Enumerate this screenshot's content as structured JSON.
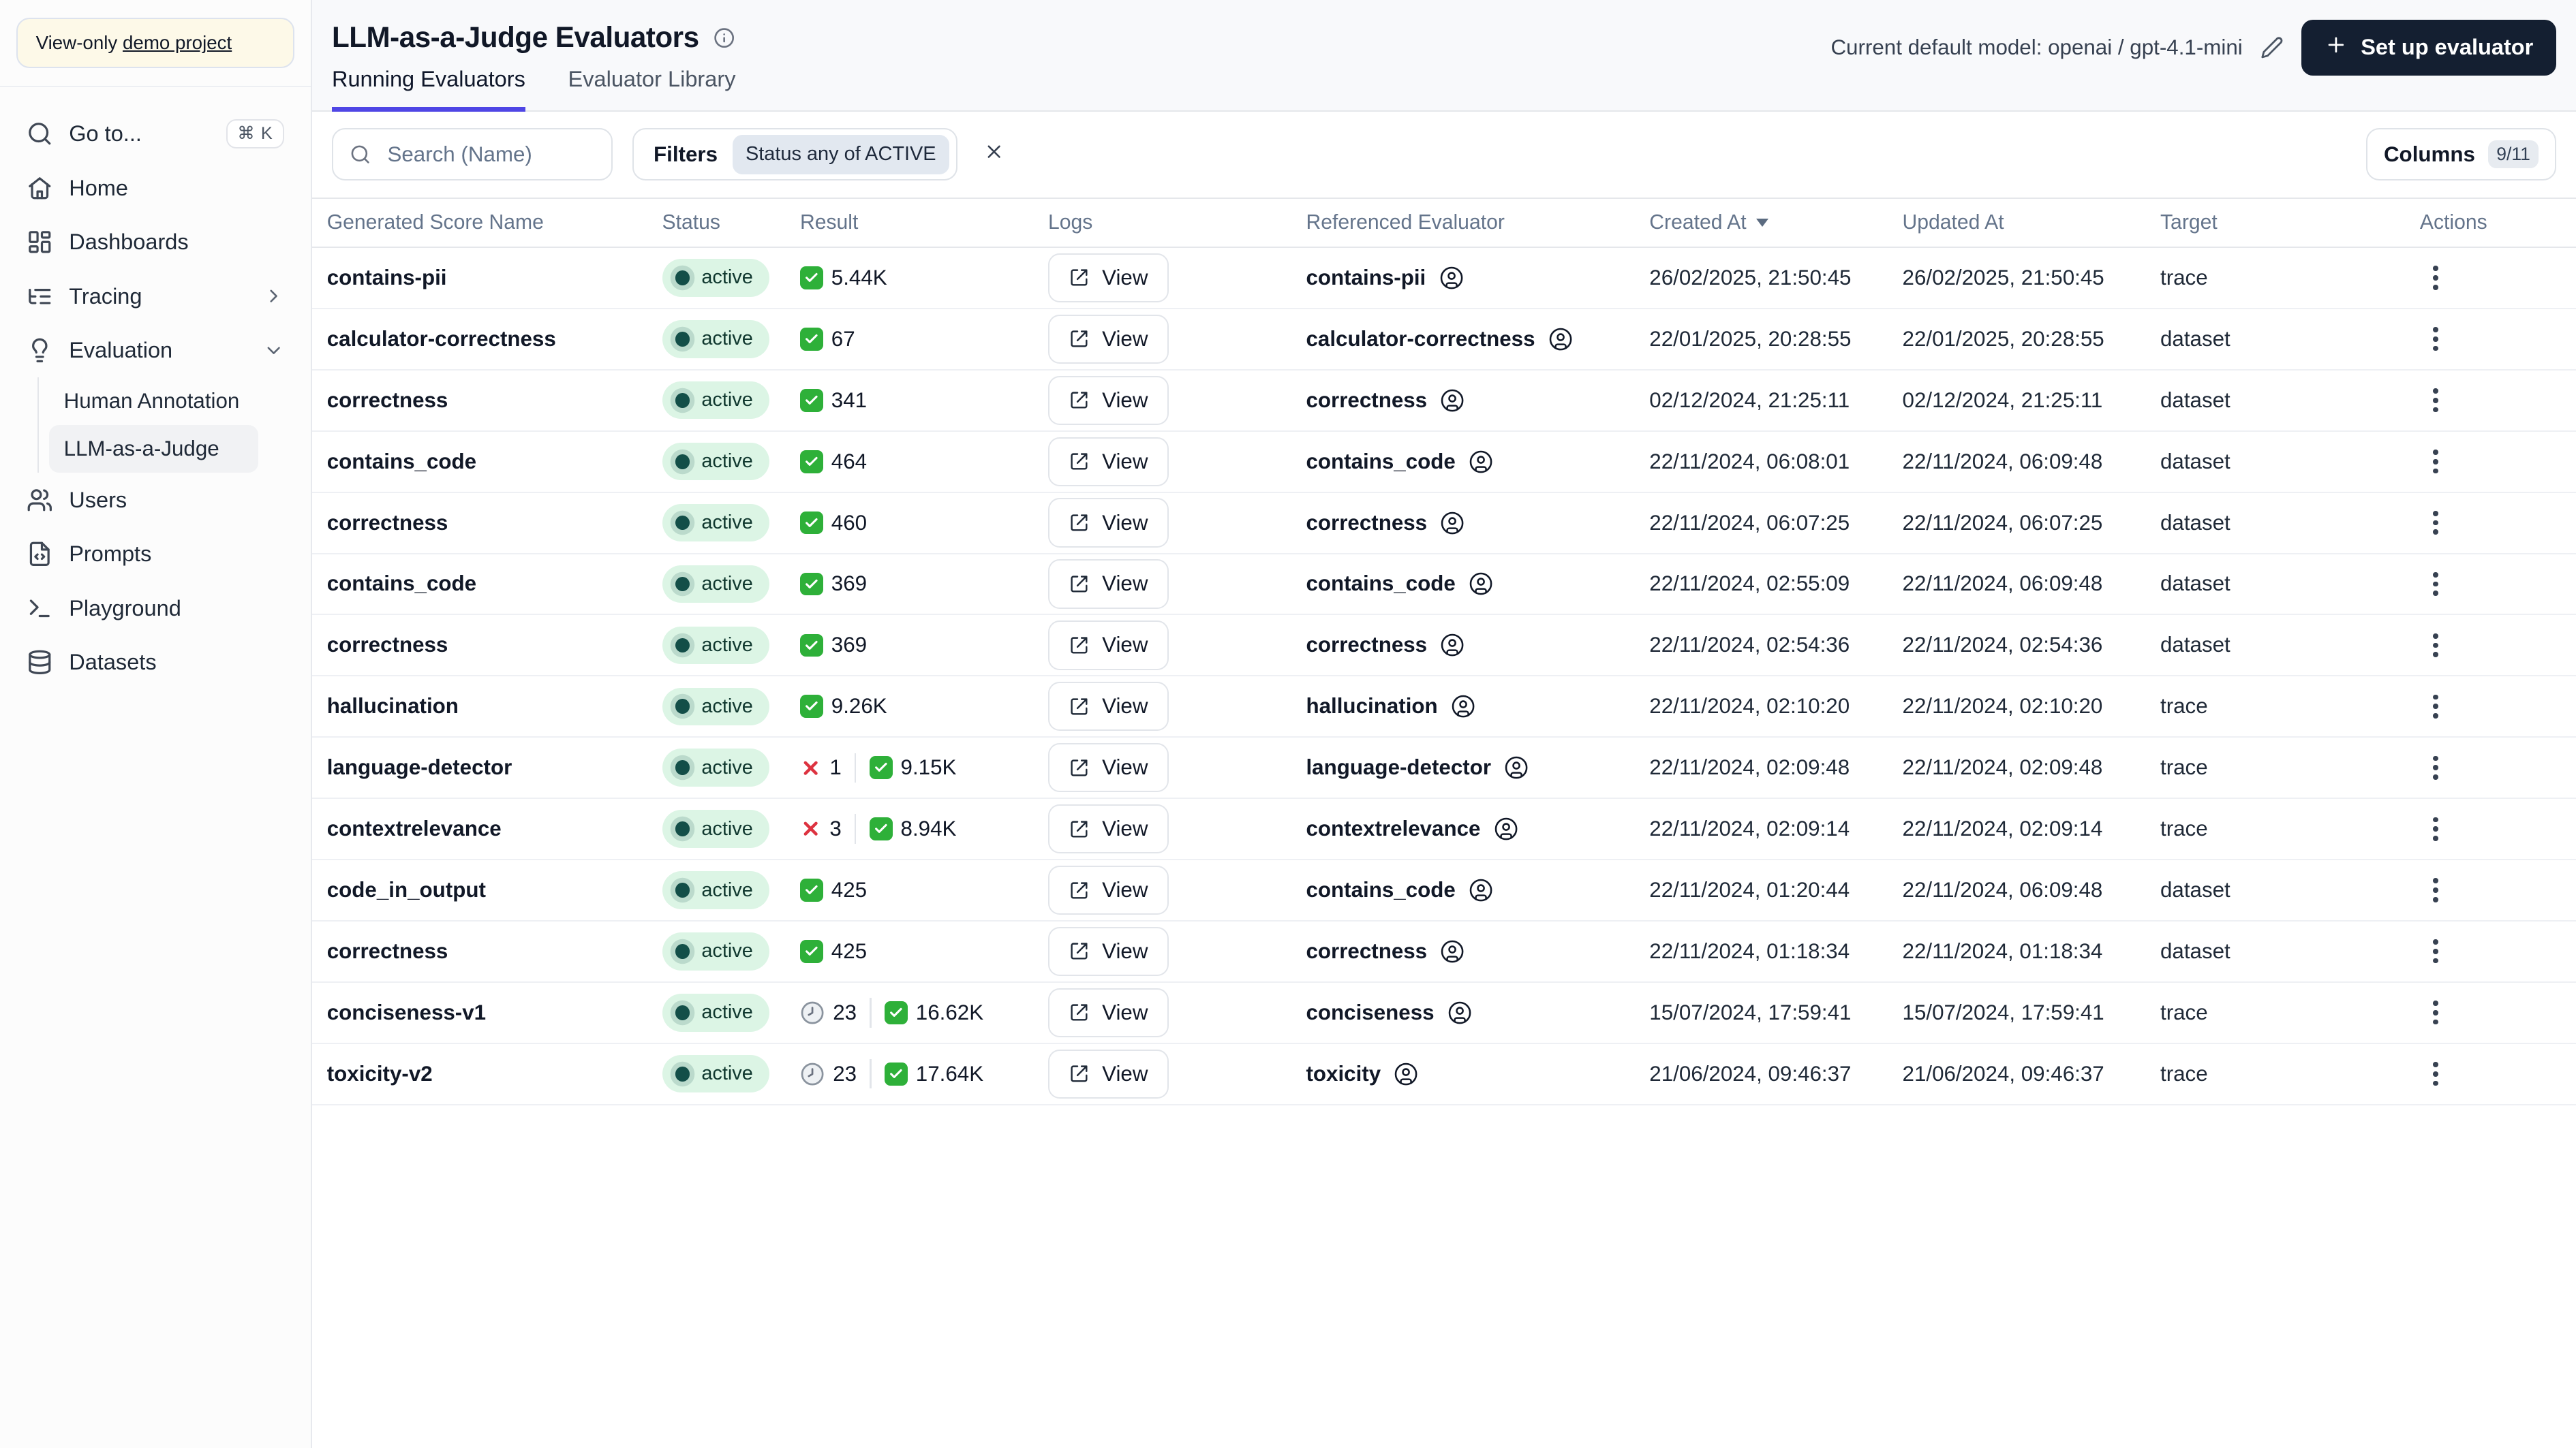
{
  "colors": {
    "accent": "#4f46e5",
    "active_badge_bg": "#dcf5e5",
    "active_dot": "#134e48",
    "success_green": "#2eb039",
    "error_red": "#dd3340",
    "dark_button": "#141f31",
    "banner_bg": "#fdf9e8"
  },
  "sidebar": {
    "banner": {
      "prefix": "View-only ",
      "link": "demo project"
    },
    "go_to": {
      "icon": "search",
      "label": "Go to...",
      "shortcut": "⌘ K"
    },
    "nav": [
      {
        "icon": "home",
        "label": "Home"
      },
      {
        "icon": "dashboards",
        "label": "Dashboards"
      },
      {
        "icon": "tracing",
        "label": "Tracing",
        "chevron": "right"
      },
      {
        "icon": "evaluation",
        "label": "Evaluation",
        "chevron": "down",
        "children": [
          {
            "label": "Human Annotation",
            "selected": false
          },
          {
            "label": "LLM-as-a-Judge",
            "selected": true
          }
        ]
      },
      {
        "icon": "users",
        "label": "Users"
      },
      {
        "icon": "prompts",
        "label": "Prompts"
      },
      {
        "icon": "playground",
        "label": "Playground"
      },
      {
        "icon": "datasets",
        "label": "Datasets"
      }
    ]
  },
  "header": {
    "title": "LLM-as-a-Judge Evaluators",
    "model_label": "Current default model: openai / gpt-4.1-mini",
    "setup_label": "Set up evaluator"
  },
  "tabs": [
    {
      "label": "Running Evaluators",
      "active": true
    },
    {
      "label": "Evaluator Library",
      "active": false
    }
  ],
  "toolbar": {
    "search_placeholder": "Search (Name)",
    "filters_label": "Filters",
    "filter_chip": "Status any of ACTIVE",
    "columns_label": "Columns",
    "columns_badge": "9/11"
  },
  "table": {
    "columns": [
      "Generated Score Name",
      "Status",
      "Result",
      "Logs",
      "Referenced Evaluator",
      "Created At",
      "Updated At",
      "Target",
      "Actions"
    ],
    "sorted_by": "Created At",
    "sort_direction": "desc",
    "view_label": "View",
    "rows": [
      {
        "name": "contains-pii",
        "status": "active",
        "result": {
          "success": "5.44K"
        },
        "referenced": "contains-pii",
        "created": "26/02/2025, 21:50:45",
        "updated": "26/02/2025, 21:50:45",
        "target": "trace"
      },
      {
        "name": "calculator-correctness",
        "status": "active",
        "result": {
          "success": "67"
        },
        "referenced": "calculator-correctness",
        "created": "22/01/2025, 20:28:55",
        "updated": "22/01/2025, 20:28:55",
        "target": "dataset"
      },
      {
        "name": "correctness",
        "status": "active",
        "result": {
          "success": "341"
        },
        "referenced": "correctness",
        "created": "02/12/2024, 21:25:11",
        "updated": "02/12/2024, 21:25:11",
        "target": "dataset"
      },
      {
        "name": "contains_code",
        "status": "active",
        "result": {
          "success": "464"
        },
        "referenced": "contains_code",
        "created": "22/11/2024, 06:08:01",
        "updated": "22/11/2024, 06:09:48",
        "target": "dataset"
      },
      {
        "name": "correctness",
        "status": "active",
        "result": {
          "success": "460"
        },
        "referenced": "correctness",
        "created": "22/11/2024, 06:07:25",
        "updated": "22/11/2024, 06:07:25",
        "target": "dataset"
      },
      {
        "name": "contains_code",
        "status": "active",
        "result": {
          "success": "369"
        },
        "referenced": "contains_code",
        "created": "22/11/2024, 02:55:09",
        "updated": "22/11/2024, 06:09:48",
        "target": "dataset"
      },
      {
        "name": "correctness",
        "status": "active",
        "result": {
          "success": "369"
        },
        "referenced": "correctness",
        "created": "22/11/2024, 02:54:36",
        "updated": "22/11/2024, 02:54:36",
        "target": "dataset"
      },
      {
        "name": "hallucination",
        "status": "active",
        "result": {
          "success": "9.26K"
        },
        "referenced": "hallucination",
        "created": "22/11/2024, 02:10:20",
        "updated": "22/11/2024, 02:10:20",
        "target": "trace"
      },
      {
        "name": "language-detector",
        "status": "active",
        "result": {
          "error": "1",
          "success": "9.15K"
        },
        "referenced": "language-detector",
        "created": "22/11/2024, 02:09:48",
        "updated": "22/11/2024, 02:09:48",
        "target": "trace"
      },
      {
        "name": "contextrelevance",
        "status": "active",
        "result": {
          "error": "3",
          "success": "8.94K"
        },
        "referenced": "contextrelevance",
        "created": "22/11/2024, 02:09:14",
        "updated": "22/11/2024, 02:09:14",
        "target": "trace"
      },
      {
        "name": "code_in_output",
        "status": "active",
        "result": {
          "success": "425"
        },
        "referenced": "contains_code",
        "created": "22/11/2024, 01:20:44",
        "updated": "22/11/2024, 06:09:48",
        "target": "dataset"
      },
      {
        "name": "correctness",
        "status": "active",
        "result": {
          "success": "425"
        },
        "referenced": "correctness",
        "created": "22/11/2024, 01:18:34",
        "updated": "22/11/2024, 01:18:34",
        "target": "dataset"
      },
      {
        "name": "conciseness-v1",
        "status": "active",
        "result": {
          "pending": "23",
          "success": "16.62K"
        },
        "referenced": "conciseness",
        "created": "15/07/2024, 17:59:41",
        "updated": "15/07/2024, 17:59:41",
        "target": "trace"
      },
      {
        "name": "toxicity-v2",
        "status": "active",
        "result": {
          "pending": "23",
          "success": "17.64K"
        },
        "referenced": "toxicity",
        "created": "21/06/2024, 09:46:37",
        "updated": "21/06/2024, 09:46:37",
        "target": "trace"
      }
    ]
  }
}
